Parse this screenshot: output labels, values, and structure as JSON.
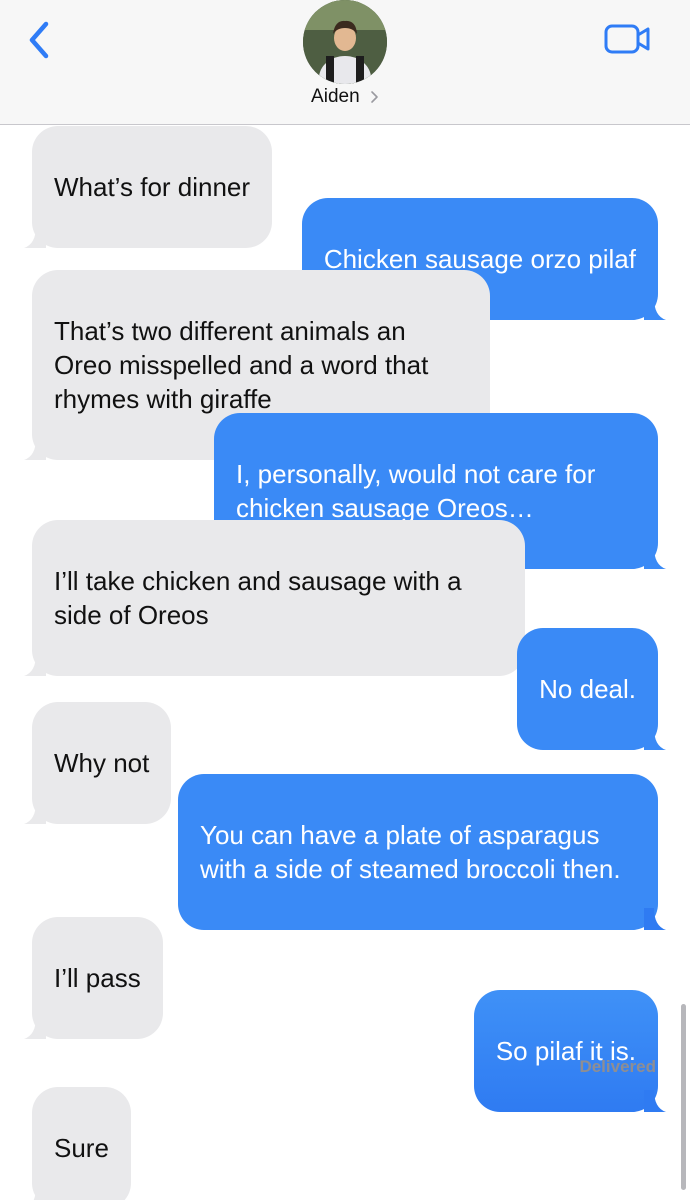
{
  "header": {
    "contact_name": "Aiden",
    "back_icon": "chevron-left-icon",
    "video_icon": "video-camera-icon",
    "accent_color": "#2f7cf6"
  },
  "messages": [
    {
      "direction": "received",
      "text": "What’s for dinner"
    },
    {
      "direction": "sent",
      "text": "Chicken sausage orzo pilaf"
    },
    {
      "direction": "received",
      "text": "That’s two different animals an Oreo misspelled and a word that rhymes with giraffe"
    },
    {
      "direction": "sent",
      "text": "I, personally, would not care for chicken sausage Oreos…"
    },
    {
      "direction": "received",
      "text": "I’ll take chicken and sausage with a side of Oreos"
    },
    {
      "direction": "sent",
      "text": "No deal."
    },
    {
      "direction": "received",
      "text": "Why not"
    },
    {
      "direction": "sent",
      "text": "You can have a plate of asparagus with a side of steamed broccoli then."
    },
    {
      "direction": "received",
      "text": "I’ll pass"
    },
    {
      "direction": "sent",
      "text": "So pilaf it is."
    },
    {
      "direction": "received",
      "text": "Sure"
    }
  ],
  "status": {
    "delivered_label": "Delivered"
  },
  "colors": {
    "sent_bubble": "#3a8af6",
    "received_bubble": "#e9e9eb",
    "header_bg": "#f7f7f7"
  }
}
